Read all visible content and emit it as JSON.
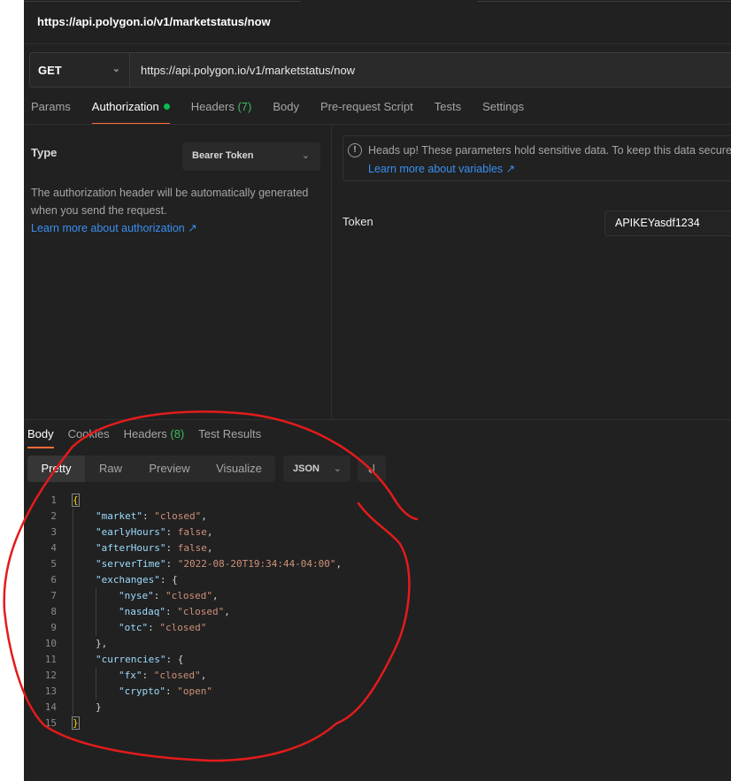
{
  "request": {
    "title": "https://api.polygon.io/v1/marketstatus/now",
    "method": "GET",
    "url": "https://api.polygon.io/v1/marketstatus/now"
  },
  "request_tabs": [
    {
      "label": "Params"
    },
    {
      "label": "Authorization",
      "indicator": "green-dot",
      "active": true
    },
    {
      "label": "Headers",
      "count": "(7)"
    },
    {
      "label": "Body"
    },
    {
      "label": "Pre-request Script"
    },
    {
      "label": "Tests"
    },
    {
      "label": "Settings"
    }
  ],
  "auth": {
    "type_label": "Type",
    "type_value": "Bearer Token",
    "description": "The authorization header will be automatically generated when you send the request.",
    "learn_link": "Learn more about authorization ↗",
    "notice_text": "Heads up! These parameters hold sensitive data. To keep this data secure",
    "notice_link": "Learn more about variables ↗",
    "token_label": "Token",
    "token_value": "APIKEYasdf1234"
  },
  "response_tabs": [
    {
      "label": "Body",
      "active": true
    },
    {
      "label": "Cookies"
    },
    {
      "label": "Headers",
      "count": "(8)"
    },
    {
      "label": "Test Results"
    }
  ],
  "view_modes": [
    "Pretty",
    "Raw",
    "Preview",
    "Visualize"
  ],
  "format": "JSON",
  "icons": {
    "method_chevron": "chevron-down-icon",
    "notice": "info-circle-icon",
    "wrap": "wrap-lines-icon"
  },
  "colors": {
    "accent": "#ff6c37",
    "status_green": "#0cbb52",
    "link": "#3a8ff0",
    "annotation_red": "#e31b1b"
  },
  "code_lines": [
    {
      "n": "1",
      "text": "{"
    },
    {
      "n": "2",
      "key": "market",
      "value": "\"closed\"",
      "type": "string",
      "trail": ","
    },
    {
      "n": "3",
      "key": "earlyHours",
      "value": "false",
      "type": "bool",
      "trail": ","
    },
    {
      "n": "4",
      "key": "afterHours",
      "value": "false",
      "type": "bool",
      "trail": ","
    },
    {
      "n": "5",
      "key": "serverTime",
      "value": "\"2022-08-20T19:34:44-04:00\"",
      "type": "string",
      "trail": ","
    },
    {
      "n": "6",
      "key": "exchanges",
      "value": "{",
      "type": "open"
    },
    {
      "n": "7",
      "key": "nyse",
      "value": "\"closed\"",
      "type": "string",
      "trail": ",",
      "indent": 2
    },
    {
      "n": "8",
      "key": "nasdaq",
      "value": "\"closed\"",
      "type": "string",
      "trail": ",",
      "indent": 2
    },
    {
      "n": "9",
      "key": "otc",
      "value": "\"closed\"",
      "type": "string",
      "indent": 2
    },
    {
      "n": "10",
      "text": "},",
      "indent": 1
    },
    {
      "n": "11",
      "key": "currencies",
      "value": "{",
      "type": "open"
    },
    {
      "n": "12",
      "key": "fx",
      "value": "\"closed\"",
      "type": "string",
      "trail": ",",
      "indent": 2
    },
    {
      "n": "13",
      "key": "crypto",
      "value": "\"open\"",
      "type": "string",
      "indent": 2
    },
    {
      "n": "14",
      "text": "}",
      "indent": 1
    },
    {
      "n": "15",
      "text": "}"
    }
  ]
}
